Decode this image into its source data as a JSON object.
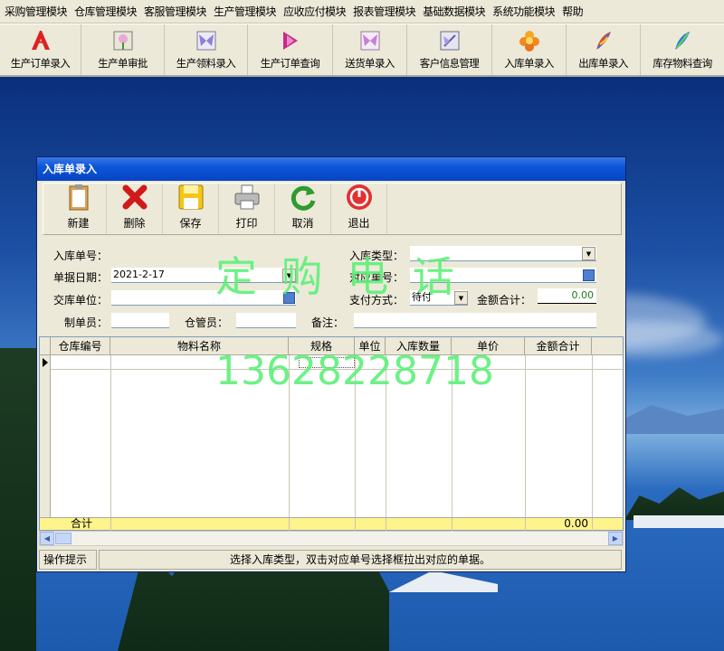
{
  "menu": [
    "采购管理模块",
    "仓库管理模块",
    "客服管理模块",
    "生产管理模块",
    "应收应付模块",
    "报表管理模块",
    "基础数据模块",
    "系统功能模块",
    "帮助"
  ],
  "toolbar": [
    {
      "label": "生产订单录入",
      "icon": "pdf-document-icon"
    },
    {
      "label": "生产单审批",
      "icon": "flower-approve-icon"
    },
    {
      "label": "生产领料录入",
      "icon": "butterfly-icon"
    },
    {
      "label": "生产订单查询",
      "icon": "magenta-arrow-icon"
    },
    {
      "label": "送货单录入",
      "icon": "butterfly-pink-icon"
    },
    {
      "label": "客户信息管理",
      "icon": "book-butterfly-icon"
    },
    {
      "label": "入库单录入",
      "icon": "orange-flower-icon"
    },
    {
      "label": "出库单录入",
      "icon": "colorful-feather-icon"
    },
    {
      "label": "库存物料查询",
      "icon": "blue-feather-icon"
    }
  ],
  "dialog": {
    "title": "入库单录入",
    "buttons": [
      {
        "label": "新建",
        "icon": "clipboard-icon"
      },
      {
        "label": "删除",
        "icon": "red-x-icon"
      },
      {
        "label": "保存",
        "icon": "floppy-disk-icon"
      },
      {
        "label": "打印",
        "icon": "printer-icon"
      },
      {
        "label": "取消",
        "icon": "green-refresh-icon"
      },
      {
        "label": "退出",
        "icon": "red-power-icon"
      }
    ],
    "form": {
      "order_no_label": "入库单号：",
      "order_no_value": "",
      "type_label": "入库类型：",
      "type_value": "",
      "date_label": "单据日期：",
      "date_value": "2021-2-17",
      "ref_label": "对应单号：",
      "ref_value": "",
      "unit_label": "交库单位：",
      "unit_value": "",
      "pay_label": "支付方式：",
      "pay_value": "待付",
      "amount_label": "金额合计：",
      "amount_value": "0.00",
      "maker_label": "制单员：",
      "maker_value": "",
      "keeper_label": "仓管员：",
      "keeper_value": "",
      "note_label": "备注：",
      "note_value": ""
    },
    "grid": {
      "columns": [
        "仓库编号",
        "物料名称",
        "规格",
        "单位",
        "入库数量",
        "单价",
        "金额合计"
      ],
      "total_label": "合计",
      "total_value": "0.00"
    },
    "status": {
      "label": "操作提示",
      "text": "选择入库类型，双击对应单号选择框拉出对应的单据。"
    }
  },
  "watermark": {
    "line1": "定 购 电  话",
    "line2": "13628228718"
  }
}
